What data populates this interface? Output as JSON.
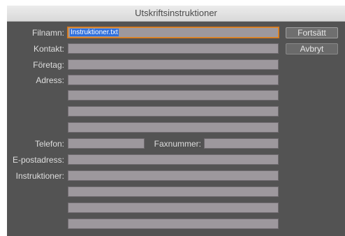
{
  "window": {
    "title": "Utskriftsinstruktioner"
  },
  "form": {
    "filename_label": "Filnamn:",
    "filename_value": "Instruktioner.txt",
    "contact_label": "Kontakt:",
    "contact_value": "",
    "company_label": "Företag:",
    "company_value": "",
    "address_label": "Adress:",
    "address_lines": [
      "",
      "",
      "",
      ""
    ],
    "phone_label": "Telefon:",
    "phone_value": "",
    "fax_label": "Faxnummer:",
    "fax_value": "",
    "email_label": "E-postadress:",
    "email_value": "",
    "instructions_label": "Instruktioner:",
    "instructions_lines": [
      "",
      "",
      "",
      ""
    ]
  },
  "buttons": {
    "continue_label": "Fortsätt",
    "cancel_label": "Avbryt"
  },
  "colors": {
    "dialog_background": "#535353",
    "field_background": "#9d989d",
    "focus_ring": "#e08a2a",
    "selection": "#2f6fdc"
  }
}
